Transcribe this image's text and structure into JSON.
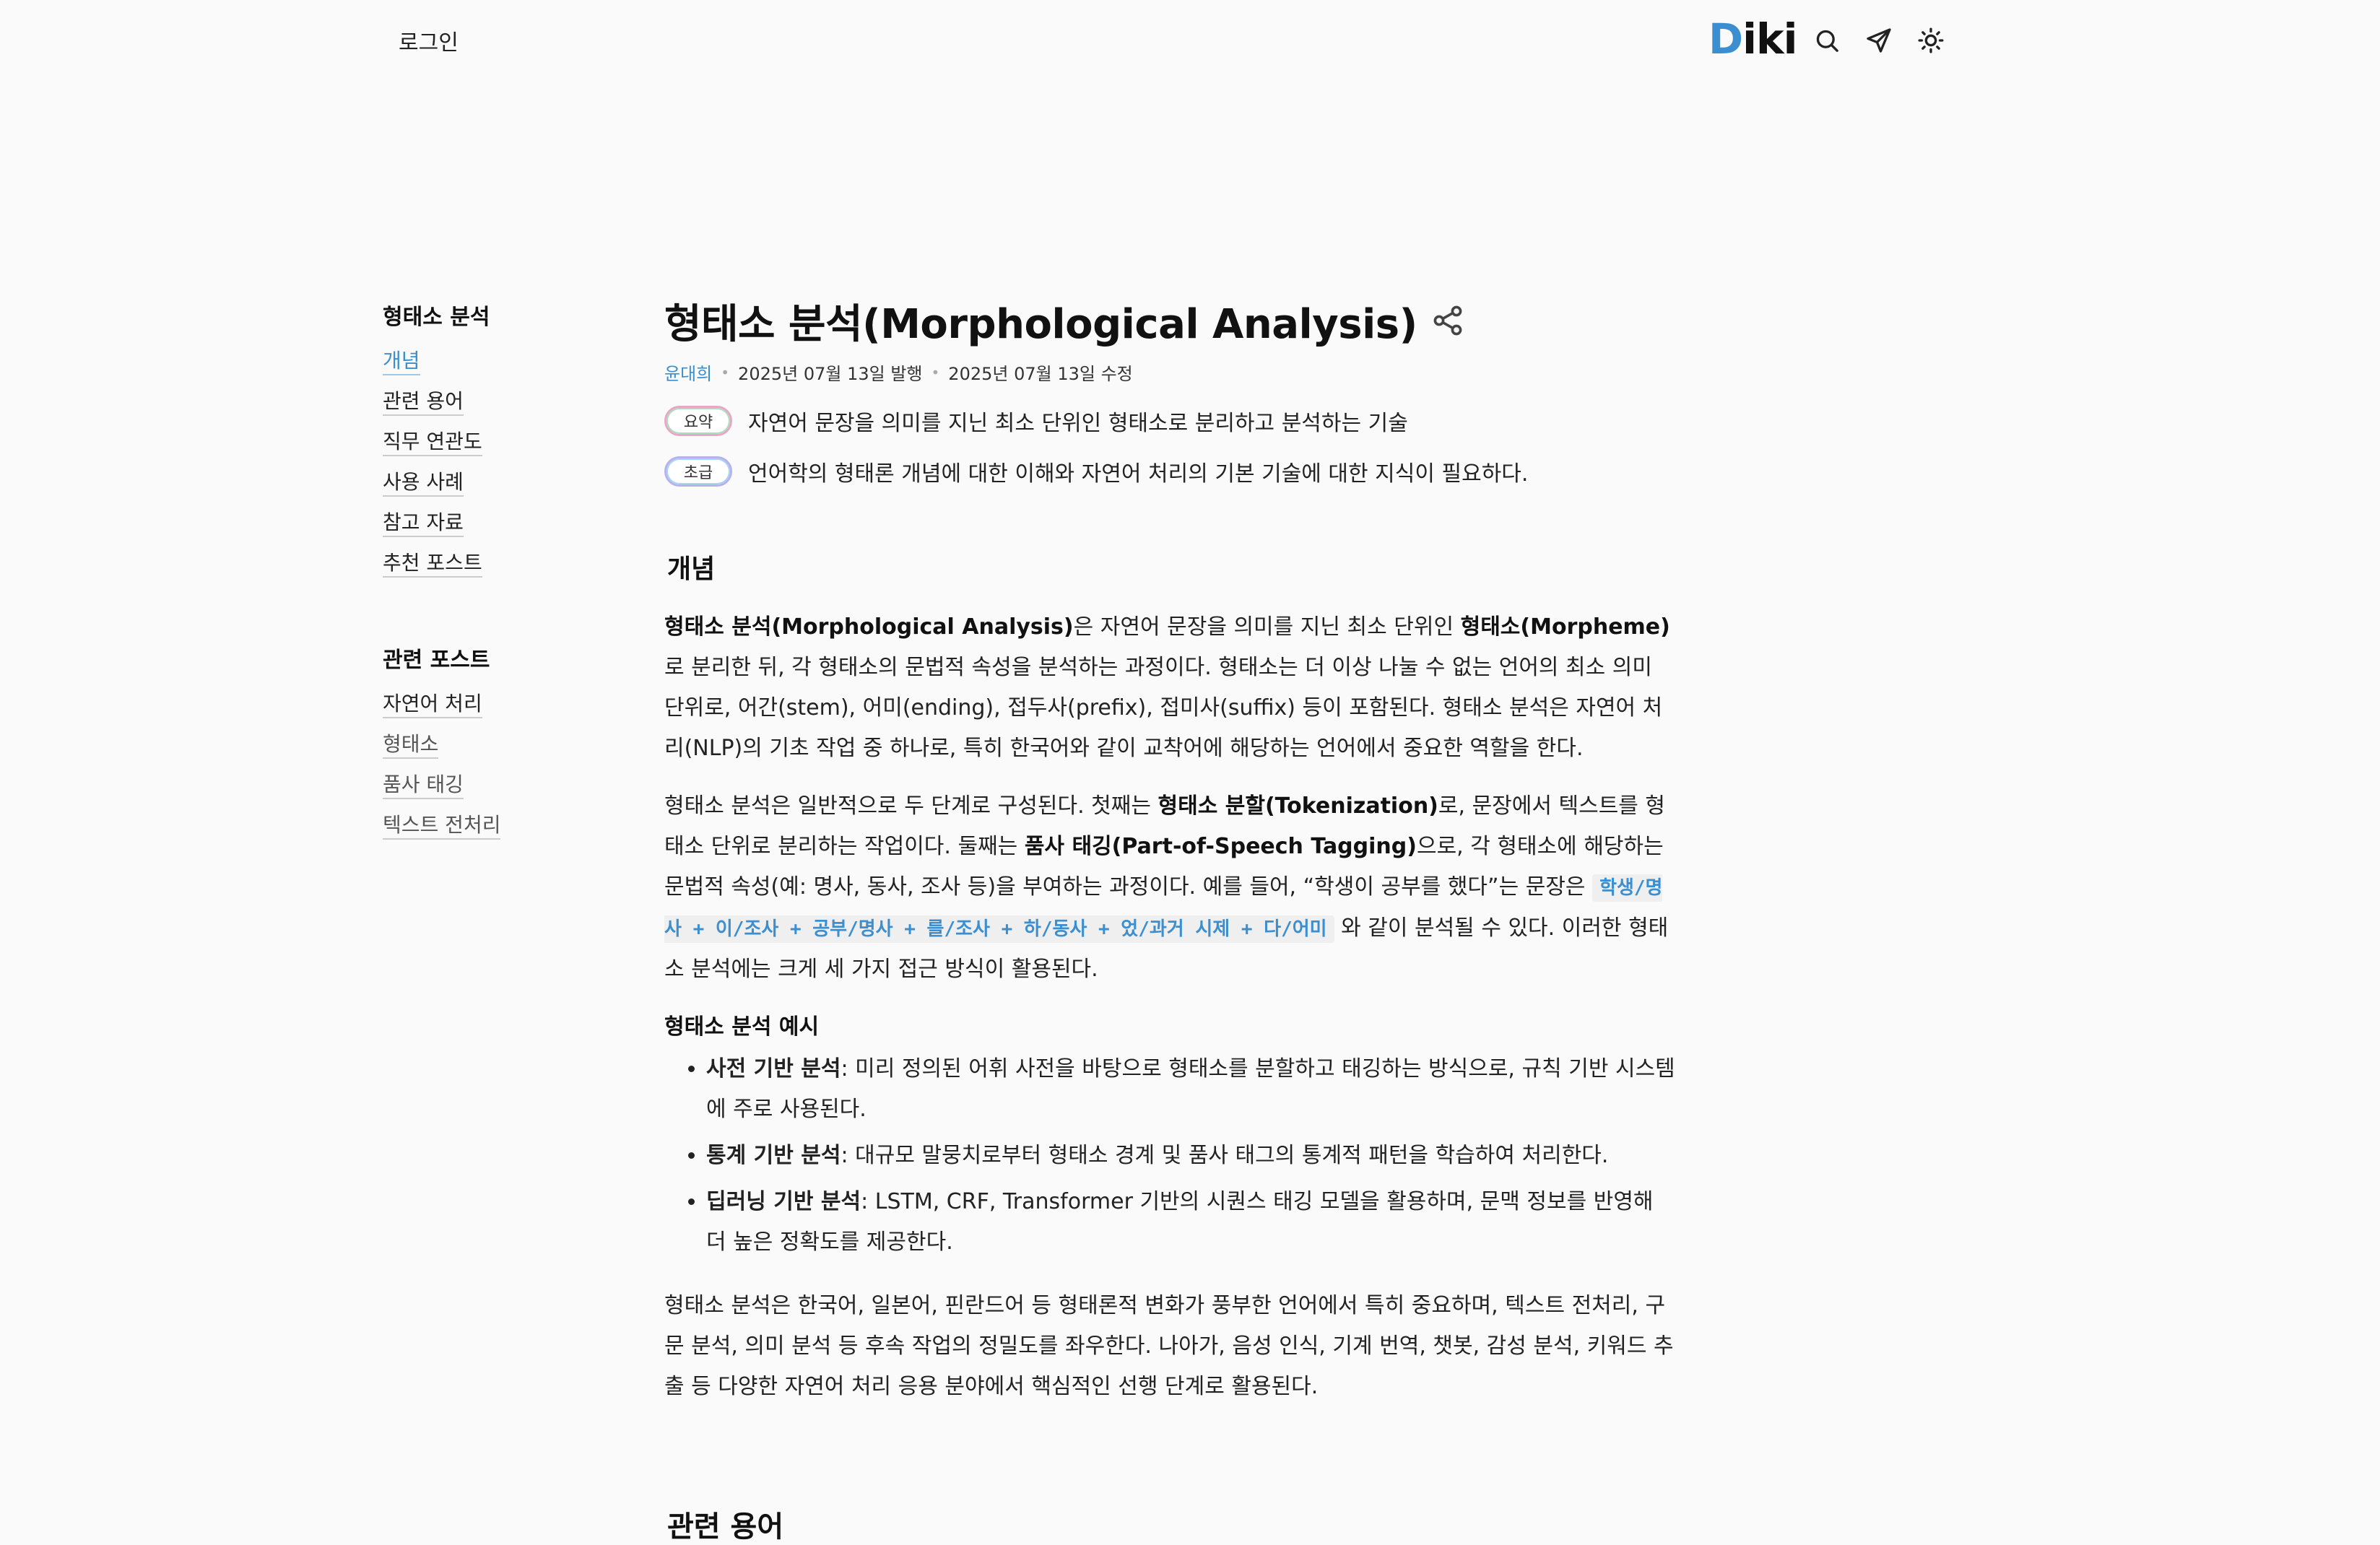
{
  "header": {
    "login_label": "로그인",
    "logo_first": "D",
    "logo_rest": "iki",
    "icons": [
      "search-icon",
      "send-icon",
      "sun-icon"
    ]
  },
  "sidebar": {
    "toc_title": "형태소 분석",
    "toc_items": [
      "개념",
      "관련 용어",
      "직무 연관도",
      "사용 사례",
      "참고 자료",
      "추천 포스트"
    ],
    "related_title": "관련 포스트",
    "related_items": [
      "자연어 처리",
      "형태소",
      "품사 태깅",
      "텍스트 전처리"
    ]
  },
  "article": {
    "title": "형태소 분석(Morphological Analysis)",
    "author": "윤대희",
    "published": "2025년 07월 13일 발행",
    "modified": "2025년 07월 13일 수정",
    "summary_label": "요약",
    "summary_text": "자연어 문장을 의미를 지닌 최소 단위인 형태소로 분리하고 분석하는 기술",
    "level_label": "초급",
    "level_text": "언어학의 형태론 개념에 대한 이해와 자연어 처리의 기본 기술에 대한 지식이 필요하다.",
    "section1_title": "개념",
    "p1_b1": "형태소 분석(Morphological Analysis)",
    "p1_t1": "은 자연어 문장을 의미를 지닌 최소 단위인 ",
    "p1_b2": "형태소(Morpheme)",
    "p1_t2": "로 분리한 뒤, 각 형태소의 문법적 속성을 분석하는 과정이다. 형태소는 더 이상 나눌 수 없는 언어의 최소 의미 단위로, 어간(stem), 어미(ending), 접두사(prefix), 접미사(suffix) 등이 포함된다. 형태소 분석은 자연어 처리(NLP)의 기초 작업 중 하나로, 특히 한국어와 같이 교착어에 해당하는 언어에서 중요한 역할을 한다.",
    "p2_t1": "형태소 분석은 일반적으로 두 단계로 구성된다. 첫째는 ",
    "p2_b1": "형태소 분할(Tokenization)",
    "p2_t2": "로, 문장에서 텍스트를 형태소 단위로 분리하는 작업이다. 둘째는 ",
    "p2_b2": "품사 태깅(Part-of-Speech Tagging)",
    "p2_t3": "으로, 각 형태소에 해당하는 문법적 속성(예: 명사, 동사, 조사 등)을 부여하는 과정이다. 예를 들어, “학생이 공부를 했다”는 문장은 ",
    "p2_code": "학생/명사 + 이/조사 + 공부/명사 + 를/조사 + 하/동사 + 었/과거 시제 + 다/어미",
    "p2_t4": " 와 같이 분석될 수 있다. 이러한 형태소 분석에는 크게 세 가지 접근 방식이 활용된다.",
    "example_title": "형태소 분석 예시",
    "bullets": [
      {
        "bold": "사전 기반 분석",
        "text": ": 미리 정의된 어휘 사전을 바탕으로 형태소를 분할하고 태깅하는 방식으로, 규칙 기반 시스템에 주로 사용된다."
      },
      {
        "bold": "통계 기반 분석",
        "text": ": 대규모 말뭉치로부터 형태소 경계 및 품사 태그의 통계적 패턴을 학습하여 처리한다."
      },
      {
        "bold": "딥러닝 기반 분석",
        "text": ": LSTM, CRF, Transformer 기반의 시퀀스 태깅 모델을 활용하며, 문맥 정보를 반영해 더 높은 정확도를 제공한다."
      }
    ],
    "p3": "형태소 분석은 한국어, 일본어, 핀란드어 등 형태론적 변화가 풍부한 언어에서 특히 중요하며, 텍스트 전처리, 구문 분석, 의미 분석 등 후속 작업의 정밀도를 좌우한다. 나아가, 음성 인식, 기계 번역, 챗봇, 감성 분석, 키워드 추출 등 다양한 자연어 처리 응용 분야에서 핵심적인 선행 단계로 활용된다.",
    "section2_title": "관련 용어"
  },
  "colors": {
    "accent": "#3b8fd0",
    "background": "#fafafa",
    "code_bg": "#efefef"
  }
}
